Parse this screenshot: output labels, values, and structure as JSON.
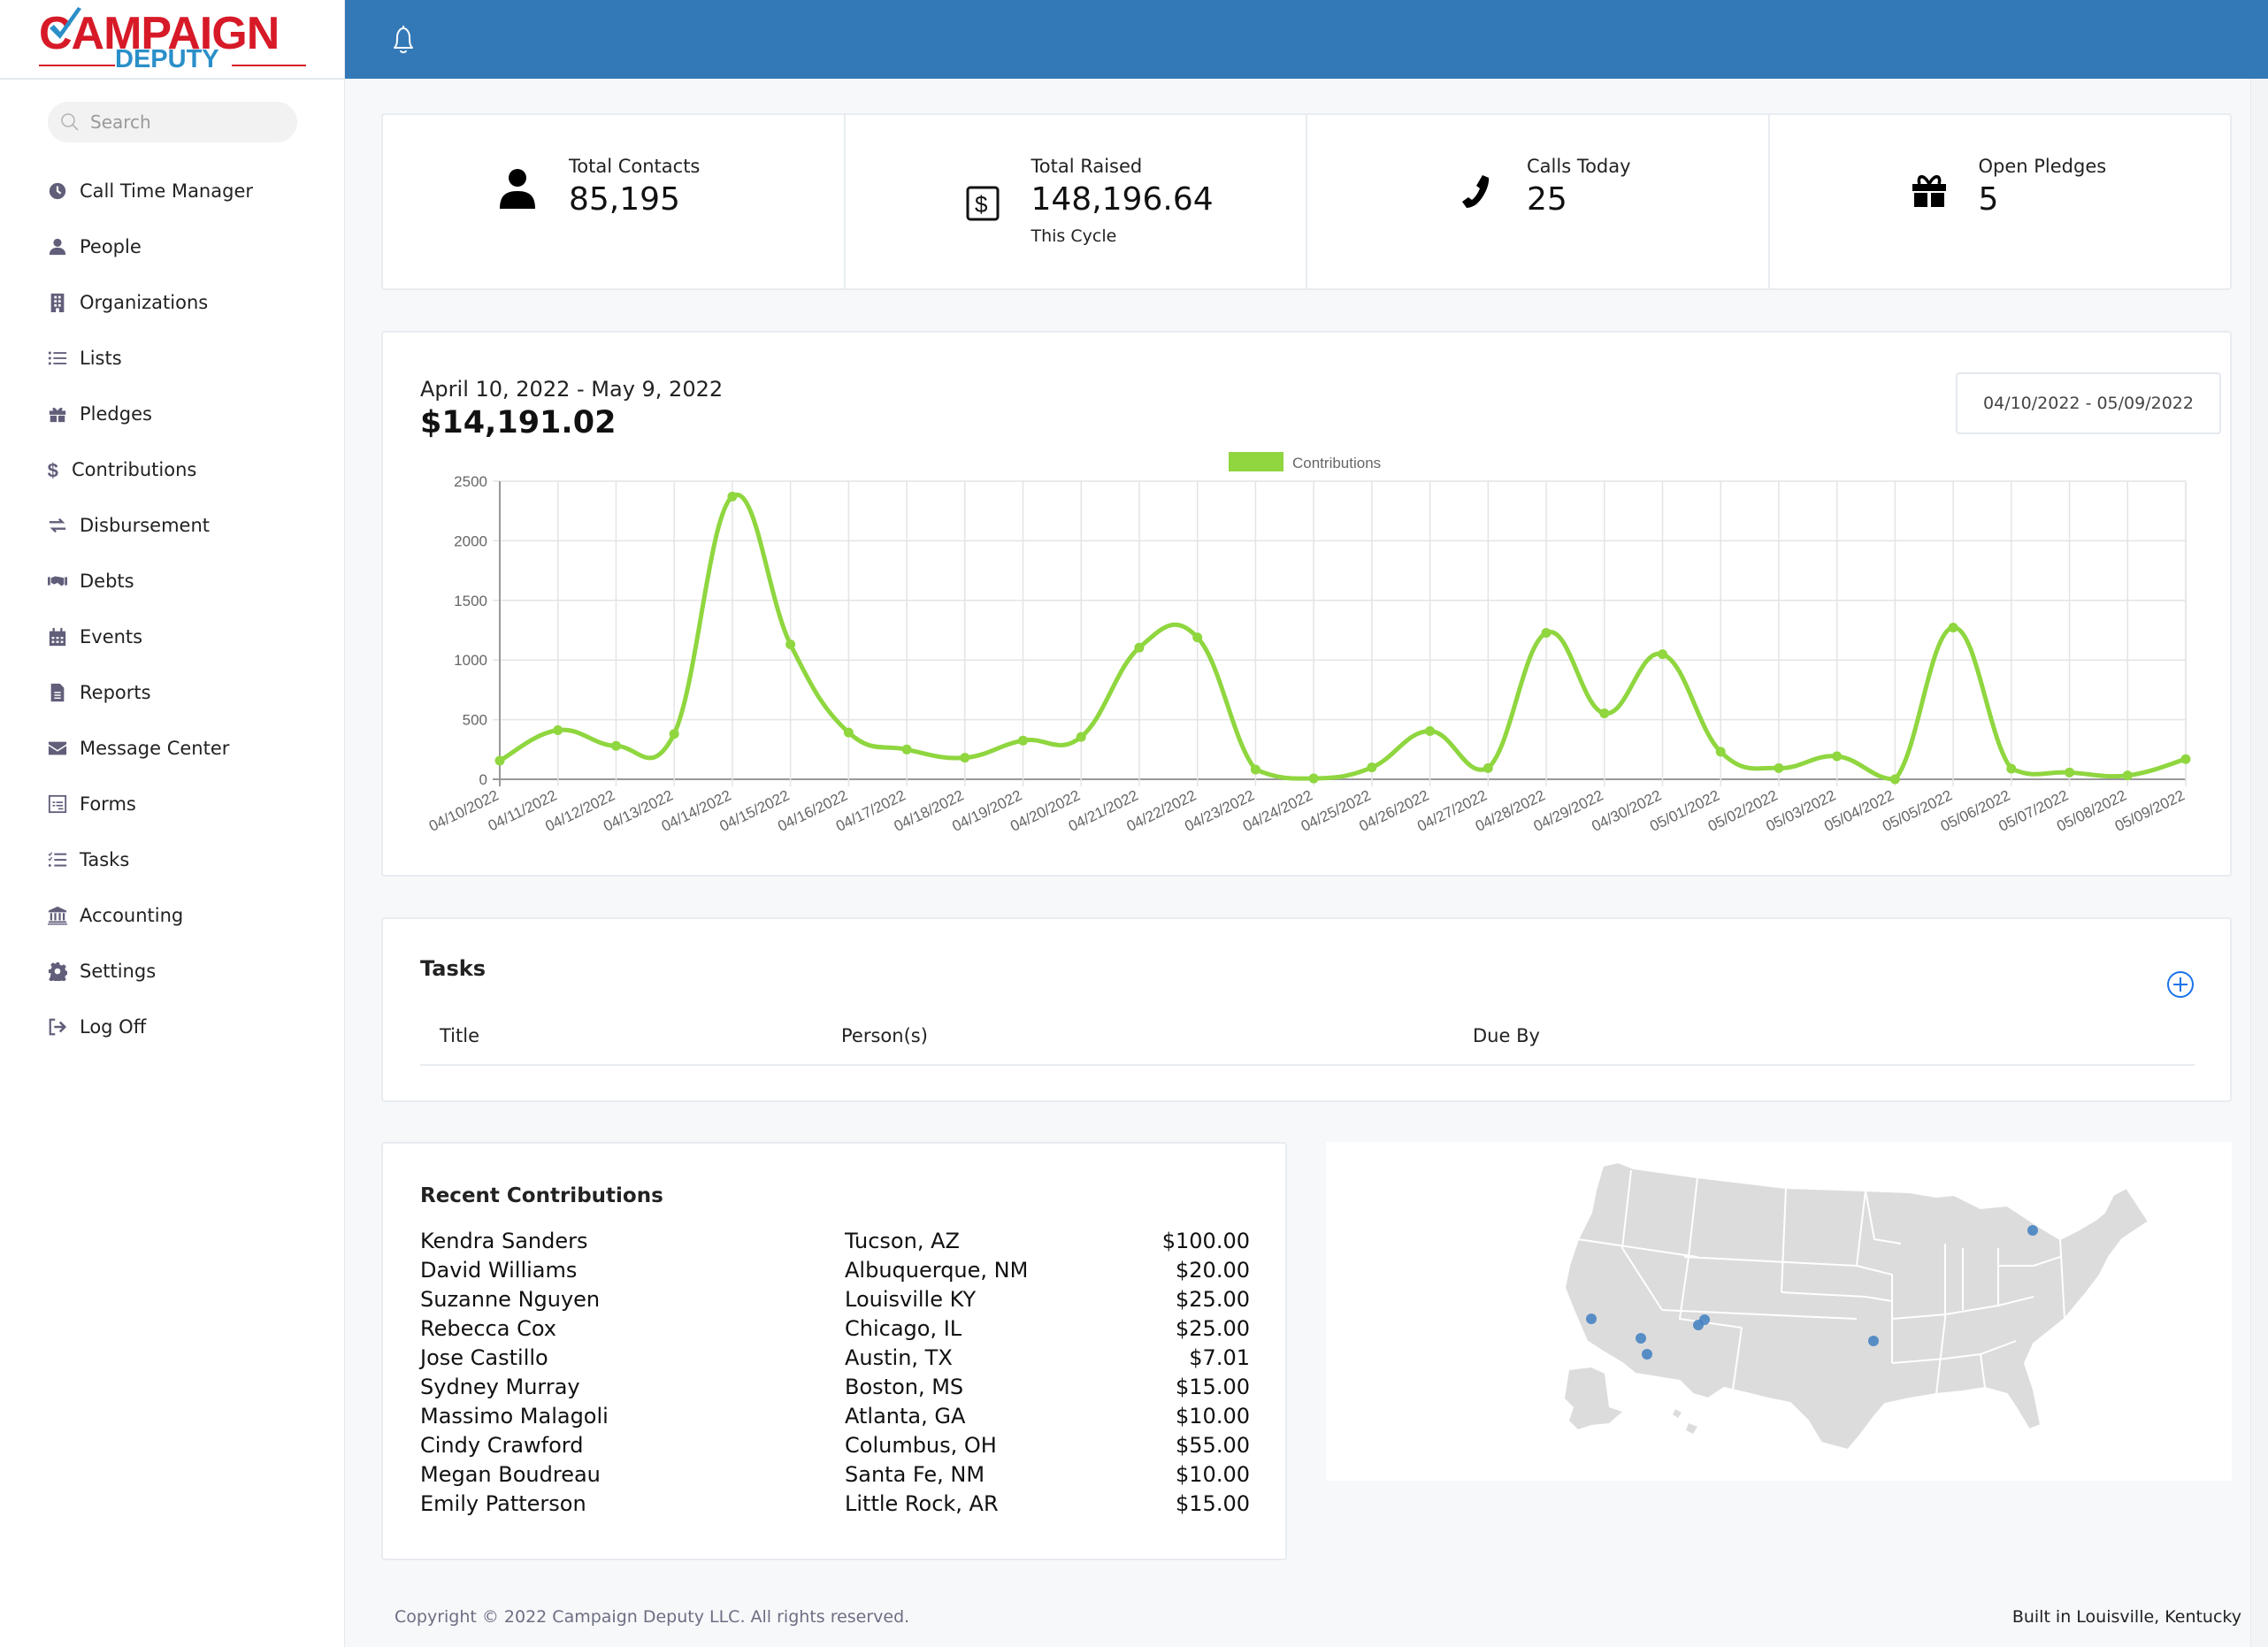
{
  "brand": {
    "name_top": "CAMPAIGN",
    "name_bottom": "DEPUTY",
    "colors": {
      "red": "#d71a28",
      "blue": "#2a8fc9"
    }
  },
  "theme": {
    "topbar": "#3479b7",
    "accent": "#1a73e8",
    "line": "#8fd63f"
  },
  "search": {
    "placeholder": "Search"
  },
  "sidebar": {
    "items": [
      {
        "label": "Call Time Manager",
        "icon": "clock-icon"
      },
      {
        "label": "People",
        "icon": "user-icon"
      },
      {
        "label": "Organizations",
        "icon": "building-icon"
      },
      {
        "label": "Lists",
        "icon": "list-icon"
      },
      {
        "label": "Pledges",
        "icon": "gift-icon"
      },
      {
        "label": "Contributions",
        "icon": "dollar-icon"
      },
      {
        "label": "Disbursement",
        "icon": "exchange-icon"
      },
      {
        "label": "Debts",
        "icon": "handshake-icon"
      },
      {
        "label": "Events",
        "icon": "calendar-icon"
      },
      {
        "label": "Reports",
        "icon": "file-icon"
      },
      {
        "label": "Message Center",
        "icon": "envelope-icon"
      },
      {
        "label": "Forms",
        "icon": "form-icon"
      },
      {
        "label": "Tasks",
        "icon": "tasks-icon"
      },
      {
        "label": "Accounting",
        "icon": "bank-icon"
      },
      {
        "label": "Settings",
        "icon": "gear-icon"
      },
      {
        "label": "Log Off",
        "icon": "sign-out-icon"
      }
    ]
  },
  "header": {
    "bell_icon": "bell-icon"
  },
  "stats": [
    {
      "label": "Total Contacts",
      "value": "85,195",
      "sub": "",
      "icon": "user-icon"
    },
    {
      "label": "Total Raised",
      "value": "148,196.64",
      "sub": "This Cycle",
      "icon": "money-bill-icon"
    },
    {
      "label": "Calls Today",
      "value": "25",
      "sub": "",
      "icon": "phone-icon"
    },
    {
      "label": "Open Pledges",
      "value": "5",
      "sub": "",
      "icon": "gift-icon"
    }
  ],
  "contributions_panel": {
    "range_title": "April 10, 2022 - May 9, 2022",
    "total": "$14,191.02",
    "date_range_value": "04/10/2022 - 05/09/2022"
  },
  "chart_data": {
    "type": "line",
    "title": "",
    "xlabel": "",
    "ylabel": "",
    "legend": {
      "entries": [
        "Contributions"
      ],
      "placement": "top-center"
    },
    "grid": true,
    "ylim": [
      0,
      2500
    ],
    "yticks": [
      0,
      500,
      1000,
      1500,
      2000,
      2500
    ],
    "x": [
      "04/10/2022",
      "04/11/2022",
      "04/12/2022",
      "04/13/2022",
      "04/14/2022",
      "04/15/2022",
      "04/16/2022",
      "04/17/2022",
      "04/18/2022",
      "04/19/2022",
      "04/20/2022",
      "04/21/2022",
      "04/22/2022",
      "04/23/2022",
      "04/24/2022",
      "04/25/2022",
      "04/26/2022",
      "04/27/2022",
      "04/28/2022",
      "04/29/2022",
      "04/30/2022",
      "05/01/2022",
      "05/02/2022",
      "05/03/2022",
      "05/04/2022",
      "05/05/2022",
      "05/06/2022",
      "05/07/2022",
      "05/08/2022",
      "05/09/2022"
    ],
    "series": [
      {
        "name": "Contributions",
        "color": "#8fd63f",
        "values": [
          156,
          412,
          280,
          380,
          2371,
          1131,
          392,
          250,
          181,
          325,
          355,
          1104,
          1190,
          82,
          7,
          99,
          404,
          94,
          1228,
          553,
          1049,
          231,
          94,
          193,
          0,
          1272,
          89,
          57,
          32,
          169
        ]
      }
    ]
  },
  "tasks": {
    "title": "Tasks",
    "columns": [
      "Title",
      "Person(s)",
      "Due By"
    ],
    "rows": []
  },
  "recent_contributions": {
    "title": "Recent Contributions",
    "rows": [
      {
        "name": "Kendra Sanders",
        "location": "Tucson, AZ",
        "amount": "$100.00"
      },
      {
        "name": "David Williams",
        "location": "Albuquerque, NM",
        "amount": "$20.00"
      },
      {
        "name": "Suzanne Nguyen",
        "location": "Louisville KY",
        "amount": "$25.00"
      },
      {
        "name": "Rebecca Cox",
        "location": "Chicago, IL",
        "amount": "$25.00"
      },
      {
        "name": "Jose Castillo",
        "location": "Austin, TX",
        "amount": "$7.01"
      },
      {
        "name": "Sydney Murray",
        "location": "Boston, MS",
        "amount": "$15.00"
      },
      {
        "name": "Massimo Malagoli",
        "location": "Atlanta, GA",
        "amount": "$10.00"
      },
      {
        "name": "Cindy Crawford",
        "location": "Columbus, OH",
        "amount": "$55.00"
      },
      {
        "name": "Megan Boudreau",
        "location": "Santa Fe, NM",
        "amount": "$10.00"
      },
      {
        "name": "Emily Patterson",
        "location": "Little Rock, AR",
        "amount": "$15.00"
      }
    ]
  },
  "map": {
    "fill": "#dcdcdc",
    "marker_color": "#3f7fc1",
    "markers": [
      "Los Angeles area, CA",
      "Phoenix, AZ",
      "Tucson, AZ",
      "Albuquerque, NM",
      "Santa Fe, NM",
      "Atlanta, GA",
      "Boston, MA"
    ]
  },
  "footer": {
    "copyright": "Copyright © 2022 Campaign Deputy LLC. All rights reserved.",
    "built_in": "Built in Louisville, Kentucky"
  }
}
